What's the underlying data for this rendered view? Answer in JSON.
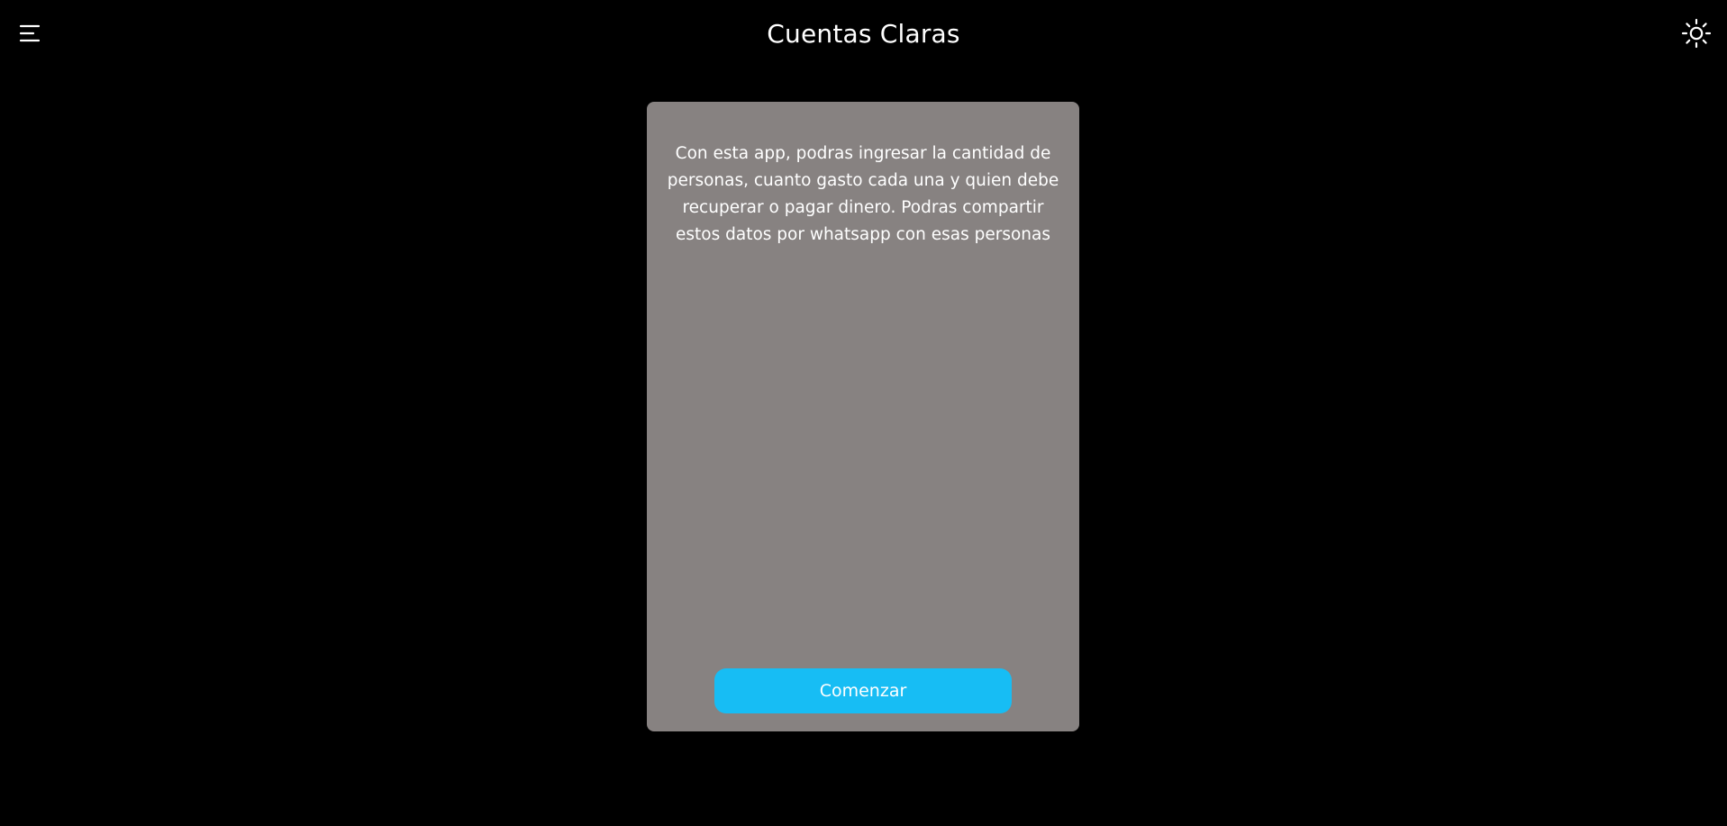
{
  "header": {
    "title": "Cuentas Claras",
    "menu_icon": "hamburger-menu-icon",
    "theme_icon": "sun-icon"
  },
  "card": {
    "description": "Con esta app, podras ingresar la cantidad de personas, cuanto gasto cada una y quien debe recuperar o pagar dinero. Podras compartir estos datos por whatsapp con esas personas",
    "start_button_label": "Comenzar"
  },
  "colors": {
    "background": "#000000",
    "card": "#878281",
    "accent": "#17bdf4",
    "text": "#ffffff"
  }
}
